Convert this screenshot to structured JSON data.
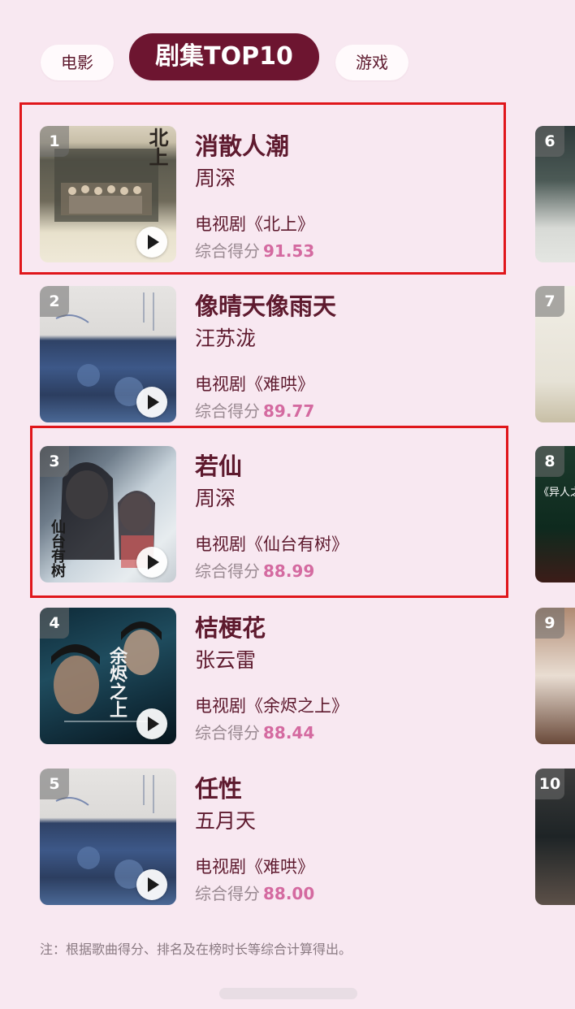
{
  "tabs": [
    {
      "label": "电影",
      "active": false
    },
    {
      "label": "剧集TOP10",
      "active": true
    },
    {
      "label": "游戏",
      "active": false
    }
  ],
  "entries": [
    {
      "rank": "1",
      "song": "消散人潮",
      "artist": "周深",
      "source": "电视剧《北上》",
      "score_label": "综合得分",
      "score": "91.53",
      "cover_text": "北上"
    },
    {
      "rank": "2",
      "song": "像晴天像雨天",
      "artist": "汪苏泷",
      "source": "电视剧《难哄》",
      "score_label": "综合得分",
      "score": "89.77",
      "cover_text": ""
    },
    {
      "rank": "3",
      "song": "若仙",
      "artist": "周深",
      "source": "电视剧《仙台有树》",
      "score_label": "综合得分",
      "score": "88.99",
      "cover_text": "仙台有树"
    },
    {
      "rank": "4",
      "song": "桔梗花",
      "artist": "张云雷",
      "source": "电视剧《余烬之上》",
      "score_label": "综合得分",
      "score": "88.44",
      "cover_text": "余烬之上"
    },
    {
      "rank": "5",
      "song": "任性",
      "artist": "五月天",
      "source": "电视剧《难哄》",
      "score_label": "综合得分",
      "score": "88.00",
      "cover_text": ""
    }
  ],
  "side_ranks": [
    "6",
    "7",
    "8",
    "9",
    "10"
  ],
  "side_text": "《异人之",
  "note": "注：根据歌曲得分、排名及在榜时长等综合计算得出。",
  "colors": {
    "background": "#f8e8f1",
    "accent": "#6d1530",
    "score": "#d46aa0",
    "highlight": "#e0161b"
  }
}
